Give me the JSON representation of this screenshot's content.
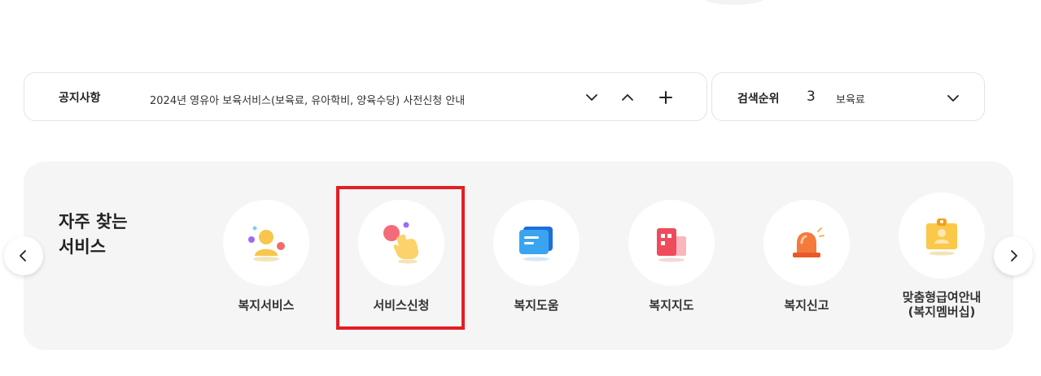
{
  "notice": {
    "label": "공지사항",
    "text": "2024년 영유아 보육서비스(보육료, 유아학비, 양육수당) 사전신청 안내",
    "controls": [
      "chevron-down-icon",
      "chevron-up-icon",
      "plus-icon"
    ]
  },
  "search_rank": {
    "label": "검색순위",
    "rank": "3",
    "term": "보육료"
  },
  "frequent": {
    "title_line1": "자주 찾는",
    "title_line2": "서비스",
    "items": [
      {
        "label": "복지서비스",
        "icon": "welfare-people-icon"
      },
      {
        "label": "서비스신청",
        "icon": "hand-tap-icon"
      },
      {
        "label": "복지도움",
        "icon": "chat-bubble-icon"
      },
      {
        "label": "복지지도",
        "icon": "building-map-icon"
      },
      {
        "label": "복지신고",
        "icon": "siren-icon"
      },
      {
        "label": "맞춤형급여안내",
        "label2": "(복지멤버십)",
        "icon": "id-badge-icon"
      }
    ]
  },
  "colors": {
    "highlight": "#e31e24",
    "panel_bg": "#f5f5f6"
  }
}
